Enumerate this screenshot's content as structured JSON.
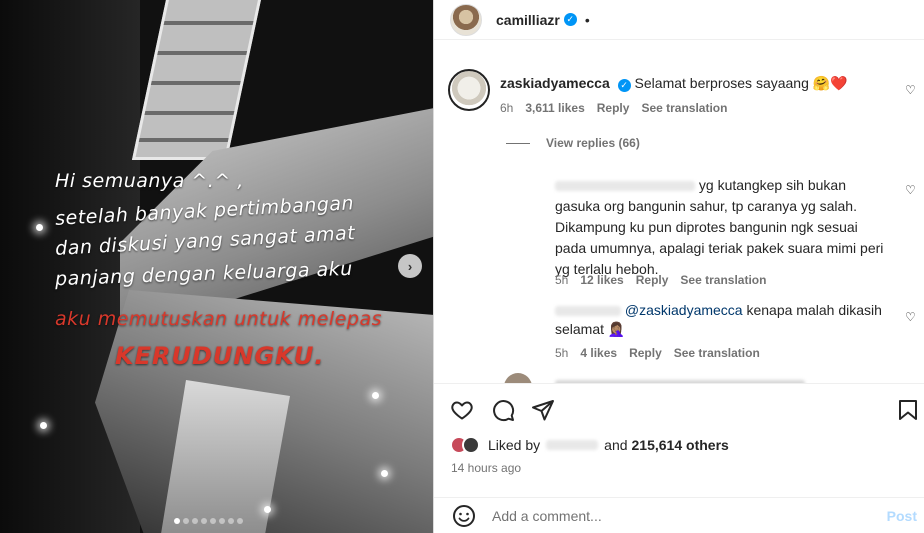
{
  "post": {
    "author": "camilliazr",
    "media": {
      "lines": [
        "Hi semuanya ^.^ ,",
        "setelah banyak pertimbangan",
        "dan diskusi yang sangat amat",
        "panjang dengan keluarga aku",
        "aku memutuskan untuk melepas",
        "KERUDUNGKU."
      ],
      "slide_count": 8,
      "active_slide": 1,
      "next_icon": "›"
    }
  },
  "comments": [
    {
      "user": "zaskiadyamecca",
      "text": "Selamat berproses sayaang 🤗❤️",
      "time": "6h",
      "likes": "3,611 likes",
      "reply": "Reply",
      "translate": "See translation",
      "view_replies": "View replies (66)"
    },
    {
      "lines": [
        "yg kutangkep sih bukan",
        "gasuka org bangunin sahur, tp caranya yg salah.",
        "Dikampung ku pun diprotes bangunin ngk sesuai",
        "pada umumnya, apalagi teriak pakek suara mimi peri",
        "yg terlalu heboh."
      ],
      "time": "5h",
      "likes": "12 likes",
      "reply": "Reply",
      "translate": "See translation"
    },
    {
      "mention": "@zaskiadyamecca",
      "text": " kenapa malah dikasih",
      "text2": "selamat 🤦🏽‍♀️",
      "time": "5h",
      "likes": "4 likes",
      "reply": "Reply",
      "translate": "See translation"
    }
  ],
  "footer": {
    "liked_by_prefix": "Liked by",
    "liked_by_suffix": "and",
    "others": "215,614 others",
    "time_ago": "14 hours ago",
    "add_comment_placeholder": "Add a comment...",
    "post_label": "Post"
  },
  "colors": {
    "verified": "#0095f6",
    "mention": "#00376b",
    "overlay_red": "#d8382b",
    "post_disabled": "#b3dbff"
  }
}
